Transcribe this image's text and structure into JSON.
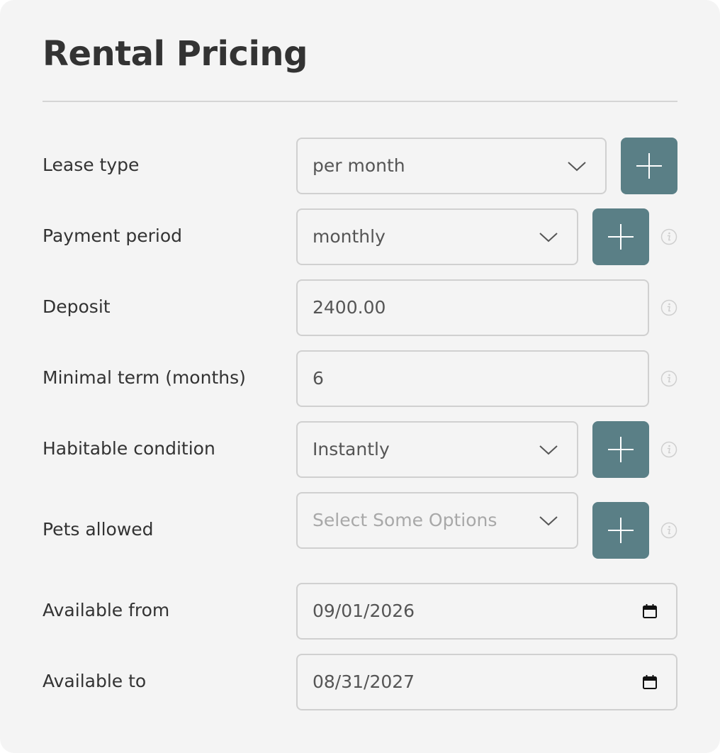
{
  "title": "Rental Pricing",
  "colors": {
    "accent": "#5a7f86",
    "background": "#f4f4f4",
    "border": "#d0d0d0",
    "text": "#333333"
  },
  "fields": [
    {
      "label": "Lease type",
      "value": "per month",
      "type": "select"
    },
    {
      "label": "Payment period",
      "value": "monthly",
      "type": "select"
    },
    {
      "label": "Deposit",
      "value": "2400.00",
      "type": "text"
    },
    {
      "label": "Minimal term (months)",
      "value": "6",
      "type": "text"
    },
    {
      "label": "Habitable condition",
      "value": "Instantly",
      "type": "select"
    },
    {
      "label": "Pets allowed",
      "placeholder": "Select Some Options",
      "type": "multiselect"
    },
    {
      "label": "Available from",
      "value": "09/01/2026",
      "type": "date"
    },
    {
      "label": "Available to",
      "value": "08/31/2027",
      "type": "date"
    }
  ],
  "icons": {
    "dropdown": "chevron-down-icon",
    "add": "plus-icon",
    "info": "info-icon",
    "date": "calendar-icon"
  }
}
